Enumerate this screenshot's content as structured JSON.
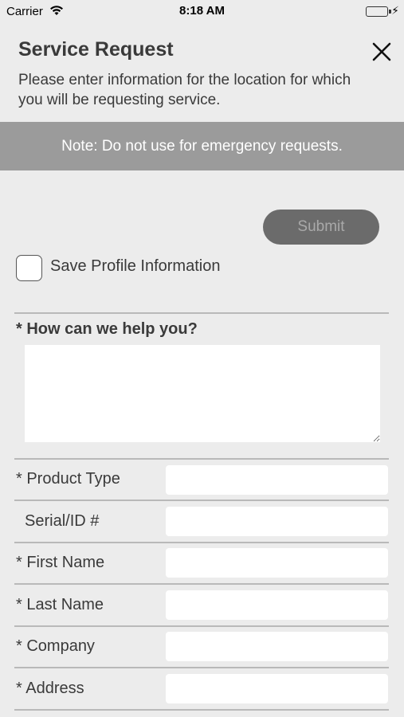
{
  "status_bar": {
    "carrier": "Carrier",
    "time": "8:18 AM",
    "wifi_icon": "wifi-icon",
    "battery_icon": "battery-icon",
    "charging_icon": "charging-bolt-icon",
    "battery_color": "#4cd964"
  },
  "header": {
    "title": "Service Request",
    "subtitle": "Please enter information for the location for which you will be requesting service.",
    "close_icon": "close-icon"
  },
  "note": {
    "text": "Note: Do not use for emergency requests.",
    "background": "#9b9b9b"
  },
  "actions": {
    "submit_label": "Submit",
    "submit_background": "#6b6b6b"
  },
  "profile": {
    "save_label": "Save Profile Information",
    "checked": false
  },
  "help": {
    "label": "* How can we help you?",
    "value": ""
  },
  "fields": [
    {
      "label": "* Product Type",
      "value": ""
    },
    {
      "label": "Serial/ID #",
      "value": ""
    },
    {
      "label": "* First Name",
      "value": ""
    },
    {
      "label": "* Last Name",
      "value": ""
    },
    {
      "label": "* Company",
      "value": ""
    },
    {
      "label": "* Address",
      "value": ""
    }
  ]
}
